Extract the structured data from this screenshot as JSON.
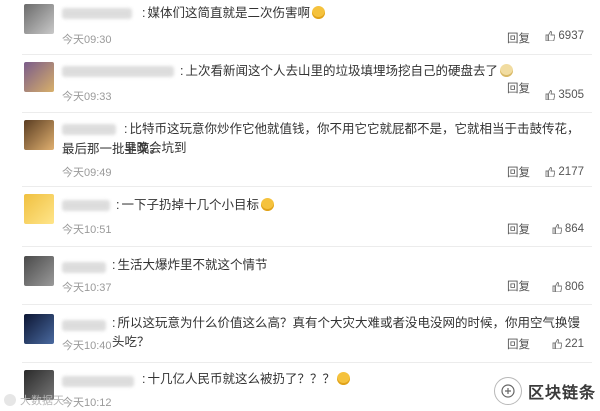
{
  "comments": [
    {
      "text": "媒体们这简直就是二次伤害啊",
      "emoji": "laugh-cry-emoji",
      "time": "今天09:30",
      "reply": "回复",
      "likes": "6937"
    },
    {
      "text": "上次看新闻这个人去山里的垃圾填埋场挖自己的硬盘去了",
      "emoji": "bear-emoji",
      "time": "今天09:33",
      "reply": "回复",
      "likes": "3505"
    },
    {
      "text_line1": "比特币这玩意你炒作它他就值钱，你不用它它就屁都不是，它就相当于击鼓传花，早晚会坑到",
      "text_line2": "最后那一批韭菜。",
      "time": "今天09:49",
      "reply": "回复",
      "likes": "2177"
    },
    {
      "text": "一下子扔掉十几个小目标",
      "emoji": "laugh-cry-emoji",
      "time": "今天10:51",
      "reply": "回复",
      "likes": "864"
    },
    {
      "text": "生活大爆炸里不就这个情节",
      "time": "今天10:37",
      "reply": "回复",
      "likes": "806"
    },
    {
      "text": "所以这玩意为什么价值这么高？真有个大灾大难或者没电没网的时候，你用空气换馒头吃？",
      "time": "今天10:40",
      "reply": "回复",
      "likes": "221"
    },
    {
      "text": "十几亿人民币就这么被扔了？？？",
      "emoji": "shocked-emoji",
      "time": "今天10:12"
    }
  ],
  "watermark": {
    "text": "区块链条",
    "source": "大数据天"
  },
  "colors": {
    "text": "#333333",
    "time": "#9a9a9a",
    "divider": "#ececec"
  }
}
